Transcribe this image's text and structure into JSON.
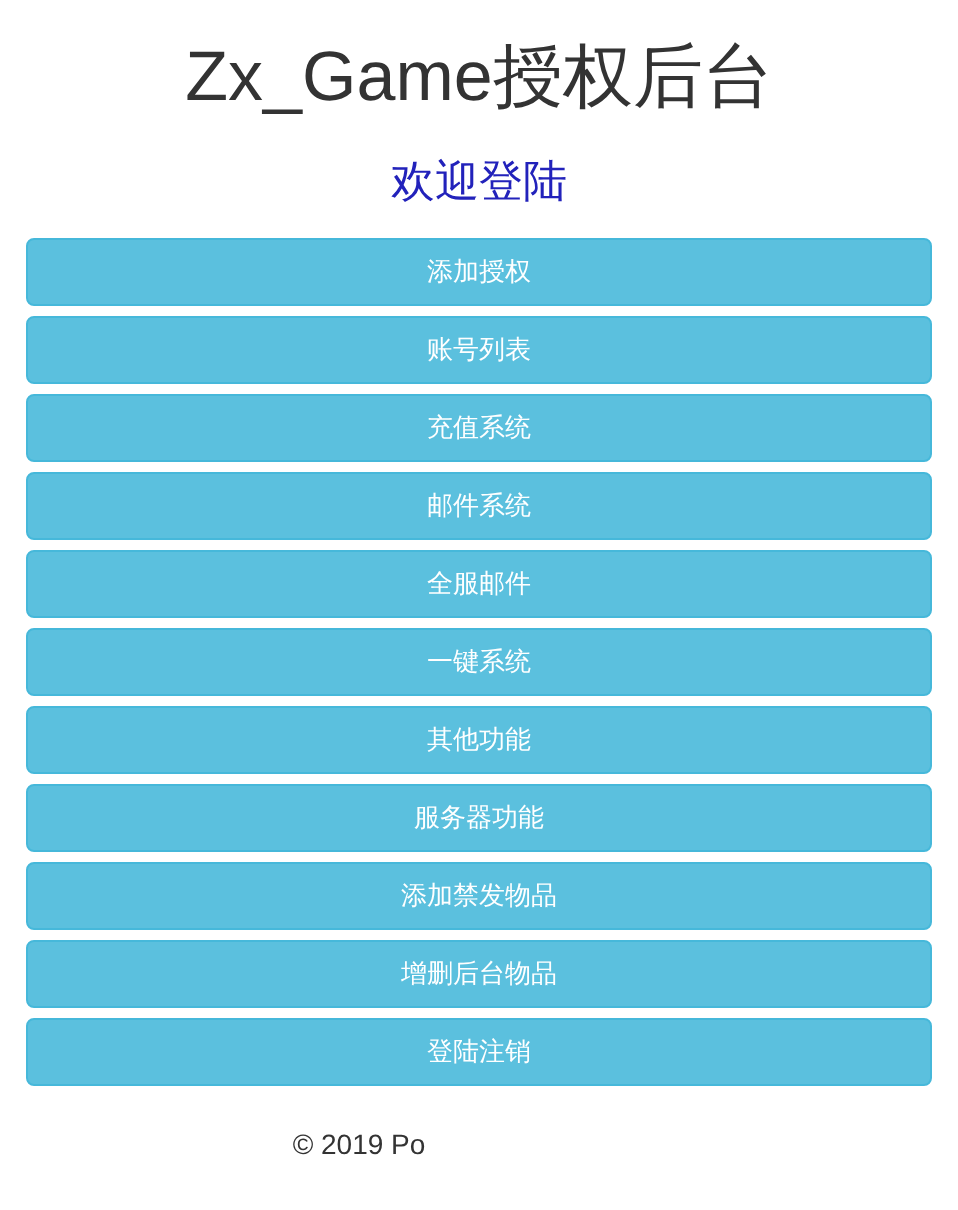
{
  "title": "Zx_Game授权后台",
  "subtitle": "欢迎登陆",
  "buttons": [
    "添加授权",
    "账号列表",
    "充值系统",
    "邮件系统",
    "全服邮件",
    "一键系统",
    "其他功能",
    "服务器功能",
    "添加禁发物品",
    "增删后台物品",
    "登陆注销"
  ],
  "footer": "© 2019 Po"
}
